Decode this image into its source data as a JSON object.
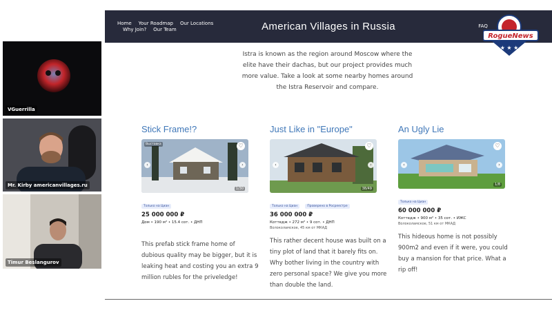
{
  "participants": [
    {
      "name": "VGuerrilla"
    },
    {
      "name": "Mr. Kirby americanvillages.ru"
    },
    {
      "name": "Timur Beslangurov"
    }
  ],
  "site": {
    "nav_links": [
      "Home",
      "Your Roadmap",
      "Our Locations",
      "Why Join?",
      "Our Team"
    ],
    "title": "American Villages in Russia",
    "nav_right": [
      "FAQ",
      "Co"
    ],
    "intro": "Istra is known as the region around Moscow where the elite have their dachas, but our project provides much more value. Take a look at some nearby homes around the Istra Reservoir and compare."
  },
  "watermark": {
    "text": "RogueNews"
  },
  "listings": [
    {
      "heading": "Stick Frame!?",
      "photo_tag": "Выставка",
      "counter": "1/30",
      "badges": [
        "Только на Циан"
      ],
      "price": "25 000 000 ₽",
      "specs": "Дом • 190 м² • 15.4 сот. • ДНП",
      "address": "",
      "description": "This prefab stick frame home of dubious quality may be bigger, but it is leaking heat and costing you an extra 9 million rubles for the priveledge!"
    },
    {
      "heading": "Just Like in \"Europe\"",
      "photo_tag": "",
      "counter": "38/49",
      "badges": [
        "Только на Циан",
        "Проверено в Росреестре"
      ],
      "price": "36 000 000 ₽",
      "specs": "Коттедж • 272 м² • 9 сот. • ДНП",
      "address": "Волоколамское, 45 км от МКАД",
      "description": "This rather decent house was built on a tiny plot of land that it barely fits on. Why bother living in the country with zero personal space? We give you more than double the land."
    },
    {
      "heading": "An Ugly Lie",
      "photo_tag": "",
      "counter": "1/8",
      "badges": [
        "Только на Циан"
      ],
      "price": "60 000 000 ₽",
      "specs": "Коттедж • 900 м² • 35 сот. • ИЖС",
      "address": "Волоколамское, 51 км от МКАД",
      "description": "This hideous home is not possibly 900m2 and even if it were, you could buy a mansion for that price. What a rip off!"
    }
  ],
  "colors": {
    "navbar": "#272a3b",
    "heading": "#3f77b8",
    "logo_red": "#c4242b",
    "logo_blue": "#1c3a7a"
  }
}
